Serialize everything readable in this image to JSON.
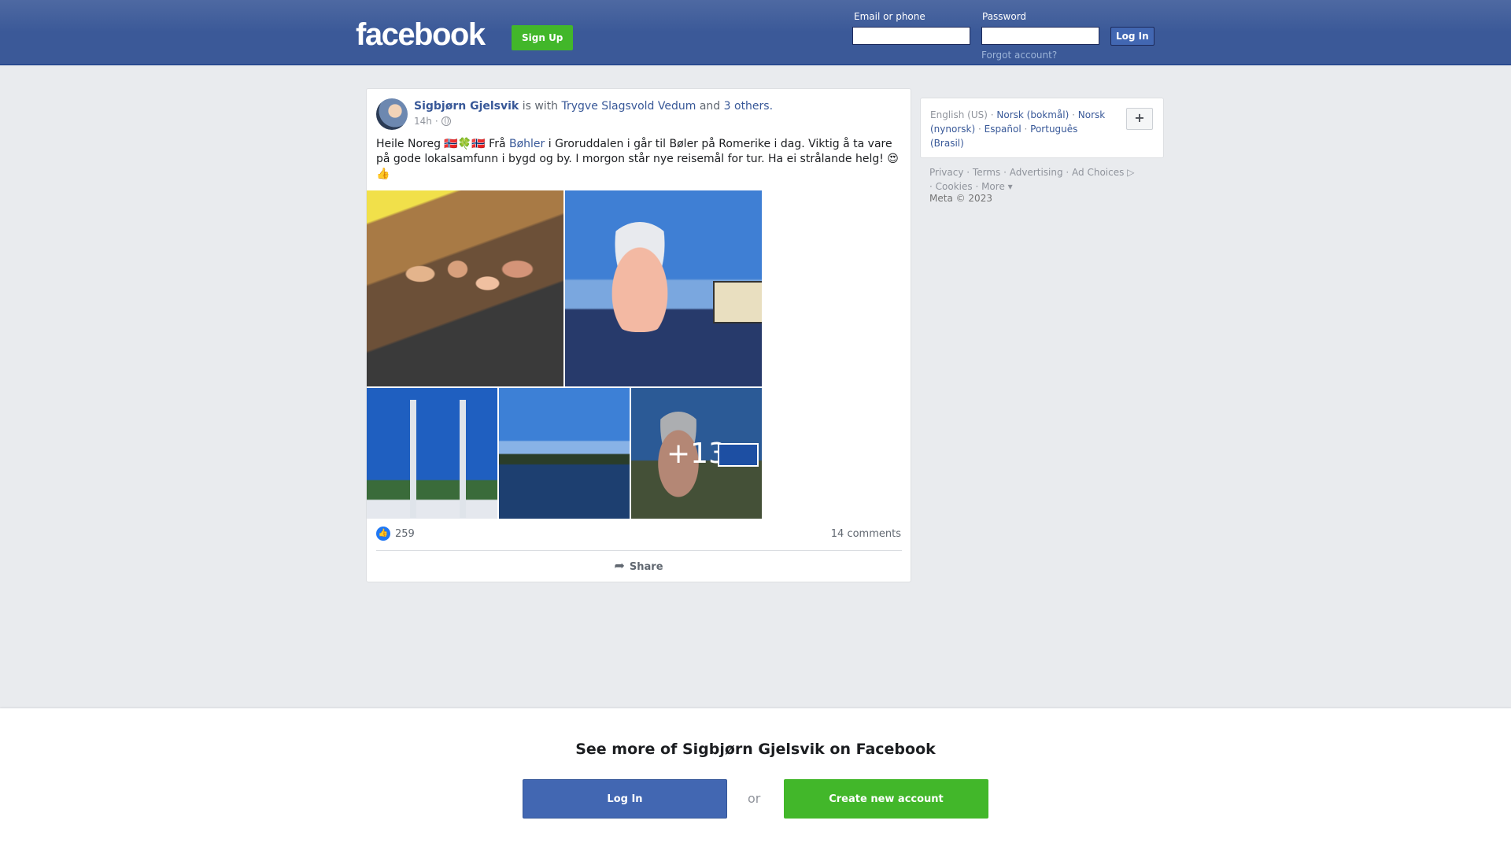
{
  "header": {
    "logo": "facebook",
    "signup_label": "Sign Up",
    "email_label": "Email or phone",
    "password_label": "Password",
    "login_label": "Log In",
    "forgot_label": "Forgot account?"
  },
  "post": {
    "author": "Sigbjørn Gjelsvik",
    "with_text": "is with",
    "tagged": "Trygve Slagsvold Vedum",
    "and_text": "and",
    "others": "3 others.",
    "time": "14h",
    "text_before_link": "Heile Noreg 🇳🇴🍀🇳🇴 Frå",
    "text_link": "Bøhler",
    "text_after_link": "i Groruddalen i går til Bøler på Romerike i dag. Viktig å ta vare på gode lokalsamfunn i bygd og by. I morgon står nye reisemål for tur. Ha ei strålande helg! 😍👍",
    "more_photos": "+13",
    "like_count": "259",
    "comments": "14 comments",
    "share_label": "Share"
  },
  "languages": {
    "current": "English (US)",
    "items": [
      "Norsk (bokmål)",
      "Norsk (nynorsk)",
      "Español",
      "Português (Brasil)"
    ],
    "more_icon": "+"
  },
  "footer": {
    "links": [
      "Privacy",
      "Terms",
      "Advertising",
      "Ad Choices",
      "Cookies",
      "More"
    ],
    "copyright": "Meta © 2023"
  },
  "banner": {
    "title": "See more of Sigbjørn Gjelsvik on Facebook",
    "login_label": "Log In",
    "or_label": "or",
    "create_label": "Create new account"
  },
  "colors": {
    "brand_blue": "#3b5998",
    "button_blue": "#4267b2",
    "green": "#42b72a",
    "link": "#385898"
  }
}
